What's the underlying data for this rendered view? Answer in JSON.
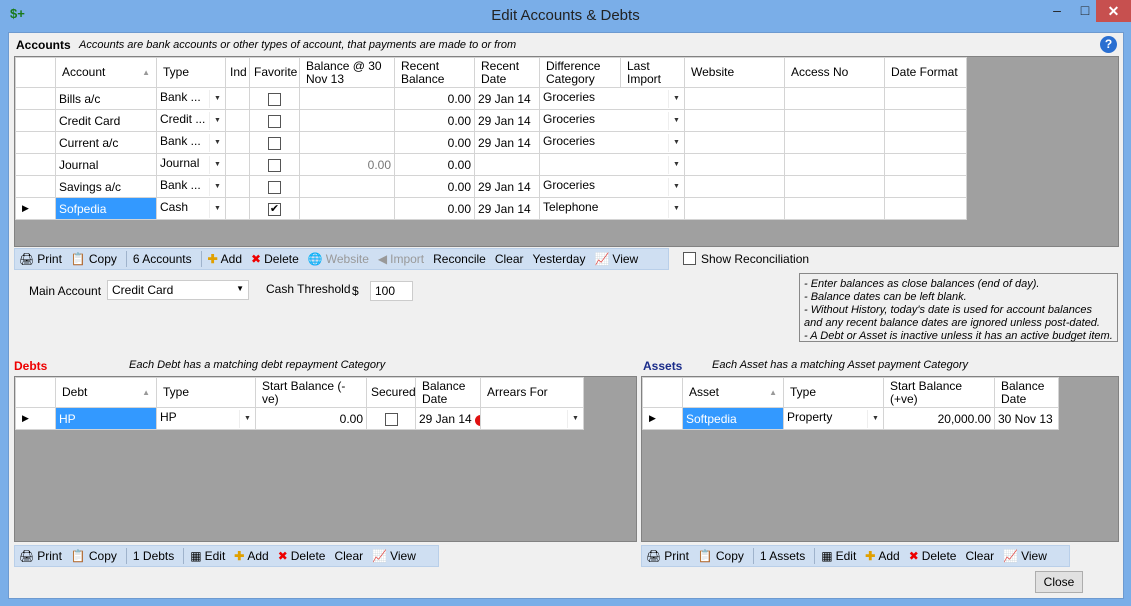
{
  "window": {
    "title": "Edit Accounts & Debts",
    "app_icon": "$+",
    "min": "–",
    "max": "□",
    "close": "✕"
  },
  "accounts": {
    "title": "Accounts",
    "subtitle": "Accounts are bank accounts or other types of account, that payments are made to or from",
    "columns": [
      "Account",
      "Type",
      "Ind",
      "Favorite",
      "Balance @ 30 Nov 13",
      "Recent Balance",
      "Recent Date",
      "Difference Category",
      "Last Import",
      "Website",
      "Access No",
      "Date Format"
    ],
    "rows": [
      {
        "account": "Bills a/c",
        "type": "Bank ...",
        "favorite": false,
        "balance": "",
        "recent_balance": "0.00",
        "recent_date": "29 Jan 14",
        "category": "Groceries"
      },
      {
        "account": "Credit Card",
        "type": "Credit ...",
        "favorite": false,
        "balance": "",
        "recent_balance": "0.00",
        "recent_date": "29 Jan 14",
        "category": "Groceries"
      },
      {
        "account": "Current a/c",
        "type": "Bank ...",
        "favorite": false,
        "balance": "",
        "recent_balance": "0.00",
        "recent_date": "29 Jan 14",
        "category": "Groceries"
      },
      {
        "account": "Journal",
        "type": "Journal",
        "favorite": false,
        "balance": "0.00",
        "recent_balance": "0.00",
        "recent_date": "",
        "category": ""
      },
      {
        "account": "Savings a/c",
        "type": "Bank ...",
        "favorite": false,
        "balance": "",
        "recent_balance": "0.00",
        "recent_date": "29 Jan 14",
        "category": "Groceries"
      },
      {
        "account": "Sofpedia",
        "type": "Cash",
        "favorite": true,
        "balance": "",
        "recent_balance": "0.00",
        "recent_date": "29 Jan 14",
        "category": "Telephone"
      }
    ],
    "toolbar": {
      "print": "Print",
      "copy": "Copy",
      "count": "6 Accounts",
      "add": "Add",
      "delete": "Delete",
      "website": "Website",
      "import": "Import",
      "reconcile": "Reconcile",
      "clear": "Clear",
      "yesterday": "Yesterday",
      "view": "View"
    },
    "show_reconciliation": "Show Reconciliation",
    "main_account_label": "Main Account",
    "main_account_value": "Credit Card",
    "cash_threshold_label": "Cash Threshold",
    "currency": "$",
    "cash_threshold_value": "100",
    "notes": [
      "- Enter balances as close balances (end of day).",
      "- Balance dates can be left blank.",
      "- Without History, today's date is used for account balances and any recent balance dates are ignored unless post-dated.",
      "- A Debt or Asset is inactive unless it has an active budget item."
    ]
  },
  "debts": {
    "title": "Debts",
    "subtitle": "Each Debt has a matching debt repayment Category",
    "columns": [
      "Debt",
      "Type",
      "Start Balance (-ve)",
      "Secured",
      "Balance Date",
      "Arrears For"
    ],
    "rows": [
      {
        "debt": "HP",
        "type": "HP",
        "start_balance": "0.00",
        "secured": false,
        "balance_date": "29 Jan 14",
        "arrears_for": ""
      }
    ],
    "toolbar": {
      "print": "Print",
      "copy": "Copy",
      "count": "1 Debts",
      "edit": "Edit",
      "add": "Add",
      "delete": "Delete",
      "clear": "Clear",
      "view": "View"
    }
  },
  "assets": {
    "title": "Assets",
    "subtitle": "Each Asset has a matching Asset payment Category",
    "columns": [
      "Asset",
      "Type",
      "Start Balance (+ve)",
      "Balance Date"
    ],
    "rows": [
      {
        "asset": "Softpedia",
        "type": "Property",
        "start_balance": "20,000.00",
        "balance_date": "30 Nov 13"
      }
    ],
    "toolbar": {
      "print": "Print",
      "copy": "Copy",
      "count": "1 Assets",
      "edit": "Edit",
      "add": "Add",
      "delete": "Delete",
      "clear": "Clear",
      "view": "View"
    }
  },
  "close_button": "Close",
  "help": "?"
}
